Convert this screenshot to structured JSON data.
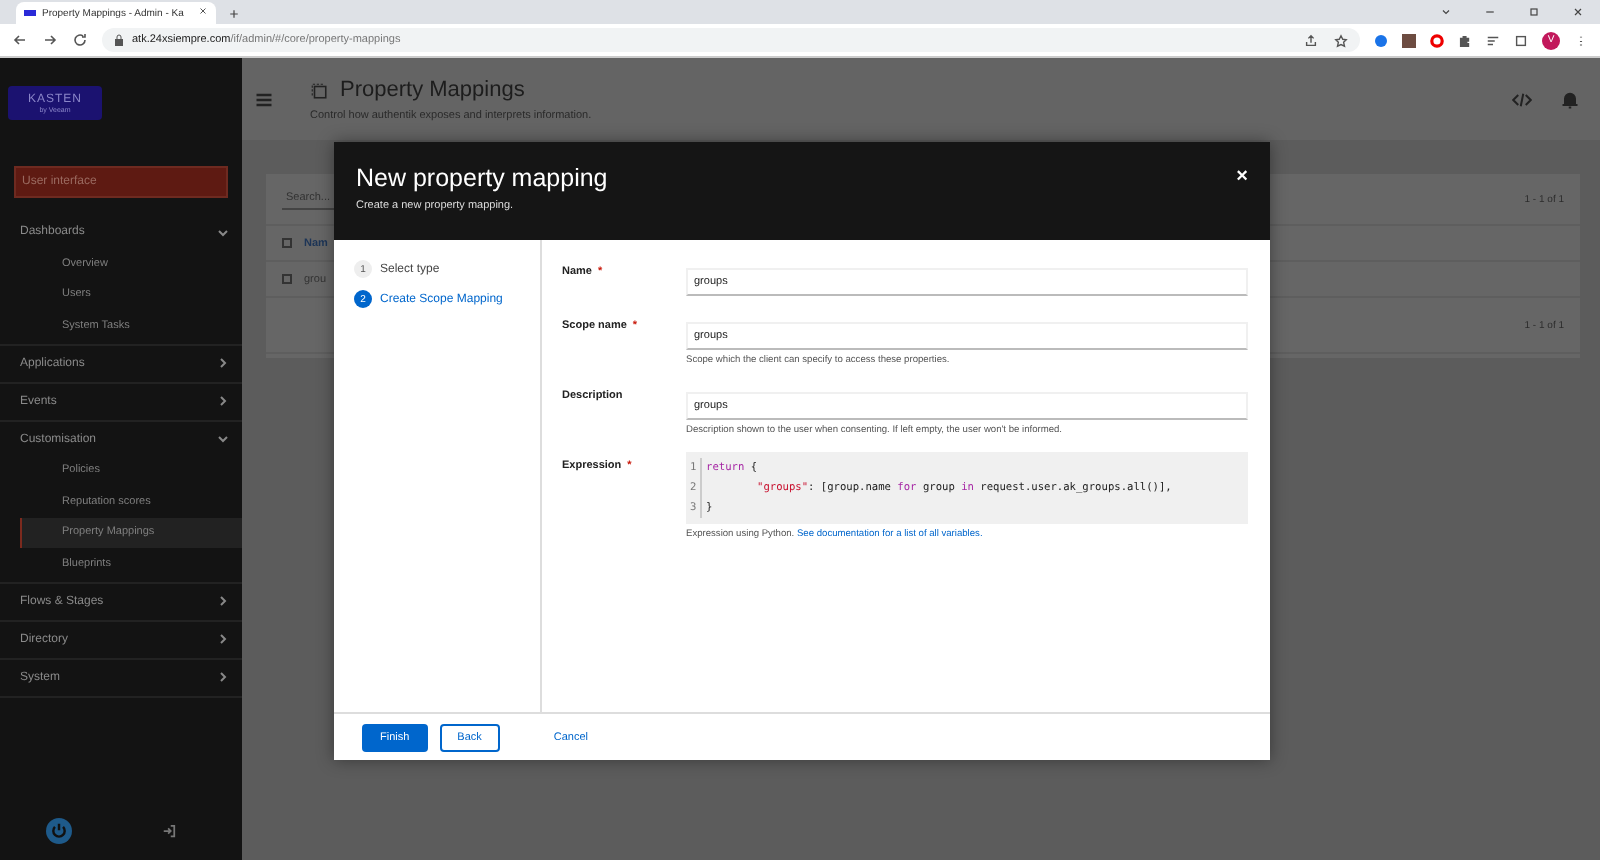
{
  "browser": {
    "tab_title": "Property Mappings - Admin - Ka",
    "url_host": "atk.24xsiempre.com",
    "url_path": "/if/admin/#/core/property-mappings",
    "avatar_letter": "V"
  },
  "sidebar": {
    "logo": {
      "title": "KASTEN",
      "subtitle": "by Veeam"
    },
    "banner": "User interface",
    "items": [
      {
        "label": "Dashboards",
        "expanded": true,
        "children": [
          {
            "label": "Overview",
            "selected": false
          },
          {
            "label": "Users",
            "selected": false
          },
          {
            "label": "System Tasks",
            "selected": false
          }
        ]
      },
      {
        "label": "Applications",
        "expanded": false
      },
      {
        "label": "Events",
        "expanded": false
      },
      {
        "label": "Customisation",
        "expanded": true,
        "children": [
          {
            "label": "Policies",
            "selected": false
          },
          {
            "label": "Reputation scores",
            "selected": false
          },
          {
            "label": "Property Mappings",
            "selected": true
          },
          {
            "label": "Blueprints",
            "selected": false
          }
        ]
      },
      {
        "label": "Flows & Stages",
        "expanded": false
      },
      {
        "label": "Directory",
        "expanded": false
      },
      {
        "label": "System",
        "expanded": false
      }
    ]
  },
  "page": {
    "title": "Property Mappings",
    "subtitle": "Control how authentik exposes and interprets information.",
    "search_placeholder": "Search...",
    "pagination_top": "1 - 1 of 1",
    "pagination_bottom": "1 - 1 of 1",
    "column_header": "Nam",
    "header_checked": false,
    "row_cell": "grou",
    "row_checked": false
  },
  "modal": {
    "title": "New property mapping",
    "subtitle": "Create a new property mapping.",
    "close_label": "×",
    "required_mark": "*",
    "steps": [
      {
        "number": "1",
        "label": "Select type",
        "selected": false
      },
      {
        "number": "2",
        "label": "Create Scope Mapping",
        "selected": true
      }
    ],
    "fields": [
      {
        "kind": "input",
        "label": "Name",
        "required": true,
        "value": "groups"
      },
      {
        "kind": "input",
        "label": "Scope name",
        "required": true,
        "value": "groups",
        "helper": "Scope which the client can specify to access these properties."
      },
      {
        "kind": "input",
        "label": "Description",
        "required": false,
        "value": "groups",
        "helper": "Description shown to the user when consenting. If left empty, the user won't be informed."
      },
      {
        "kind": "code",
        "label": "Expression",
        "required": true,
        "helper": "Expression using Python.",
        "helper_link": "See documentation for a list of all variables.",
        "lines": [
          {
            "number": "1",
            "tokens": [
              {
                "kind": "keyword",
                "text": "return"
              },
              {
                "kind": "plain",
                "text": " {"
              }
            ]
          },
          {
            "number": "2",
            "indent": true,
            "tokens": [
              {
                "kind": "string",
                "text": "\"groups\""
              },
              {
                "kind": "plain",
                "text": ": [group.name "
              },
              {
                "kind": "keyword",
                "text": "for"
              },
              {
                "kind": "plain",
                "text": " group "
              },
              {
                "kind": "keyword",
                "text": "in"
              },
              {
                "kind": "plain",
                "text": " request.user.ak_groups.all()],"
              }
            ]
          },
          {
            "number": "3",
            "tokens": [
              {
                "kind": "plain",
                "text": "}"
              }
            ]
          }
        ]
      }
    ],
    "buttons": [
      {
        "kind": "primary",
        "label": "Finish"
      },
      {
        "kind": "secondary",
        "label": "Back"
      },
      {
        "kind": "link",
        "label": "Cancel"
      }
    ]
  }
}
